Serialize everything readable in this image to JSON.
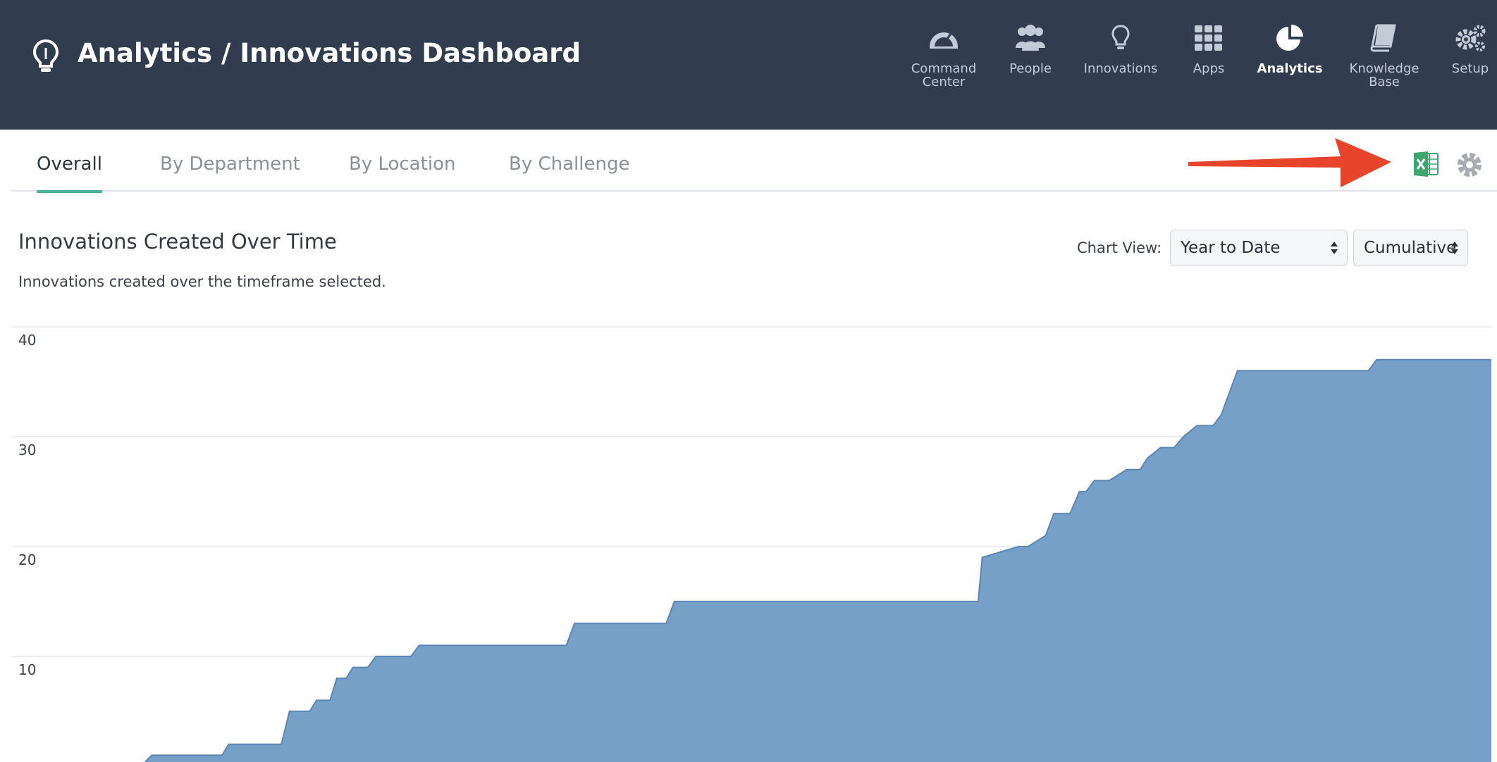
{
  "header": {
    "title": "Analytics / Innovations Dashboard",
    "nav": [
      {
        "label": "Command\nCenter",
        "icon": "gauge-icon",
        "active": false
      },
      {
        "label": "People",
        "icon": "people-icon",
        "active": false
      },
      {
        "label": "Innovations",
        "icon": "lightbulb-icon",
        "active": false
      },
      {
        "label": "Apps",
        "icon": "grid-icon",
        "active": false
      },
      {
        "label": "Analytics",
        "icon": "pie-chart-icon",
        "active": true
      },
      {
        "label": "Knowledge\nBase",
        "icon": "book-icon",
        "active": false
      },
      {
        "label": "Setup",
        "icon": "gears-icon",
        "active": false
      }
    ]
  },
  "tabs": [
    {
      "label": "Overall",
      "active": true
    },
    {
      "label": "By Department",
      "active": false
    },
    {
      "label": "By Location",
      "active": false
    },
    {
      "label": "By Challenge",
      "active": false
    }
  ],
  "toolbar": {
    "excel_icon": "excel-icon",
    "settings_icon": "gear-icon",
    "annotation_color": "#e8432b"
  },
  "chart_section": {
    "title": "Innovations Created Over Time",
    "subtitle": "Innovations created over the timeframe selected.",
    "view_label": "Chart View:",
    "range_selected": "Year to Date",
    "mode_selected": "Cumulative"
  },
  "colors": {
    "header_bg": "#313d4f",
    "accent": "#4fb39a",
    "area_fill": "#77a0c8",
    "area_stroke": "#5b86b4",
    "excel_green": "#3ea66b"
  },
  "chart_data": {
    "type": "area",
    "title": "",
    "xlabel": "",
    "ylabel": "",
    "ylim": [
      0,
      40
    ],
    "yticks": [
      10,
      20,
      30,
      40
    ],
    "grid": true,
    "legend": "none",
    "x": [
      0,
      0.008,
      0.06,
      0.065,
      0.104,
      0.11,
      0.125,
      0.13,
      0.14,
      0.145,
      0.152,
      0.157,
      0.168,
      0.174,
      0.2,
      0.206,
      0.235,
      0.241,
      0.315,
      0.321,
      0.389,
      0.395,
      0.512,
      0.518,
      0.62,
      0.623,
      0.65,
      0.657,
      0.67,
      0.676,
      0.688,
      0.695,
      0.7,
      0.706,
      0.717,
      0.73,
      0.74,
      0.745,
      0.755,
      0.76,
      0.765,
      0.772,
      0.782,
      0.794,
      0.8,
      0.812,
      0.82,
      0.83,
      0.84,
      0.909,
      0.915,
      1.0
    ],
    "series": [
      {
        "values": [
          0,
          1,
          1,
          2,
          2,
          5,
          5,
          6,
          6,
          8,
          8,
          9,
          9,
          10,
          10,
          11,
          11,
          11,
          11,
          13,
          13,
          15,
          15,
          15,
          15,
          19,
          20,
          20,
          21,
          23,
          23,
          25,
          25,
          26,
          26,
          27,
          27,
          28,
          29,
          29,
          29,
          30,
          31,
          31,
          32,
          36,
          36,
          36,
          36,
          36,
          37,
          37
        ]
      }
    ]
  }
}
